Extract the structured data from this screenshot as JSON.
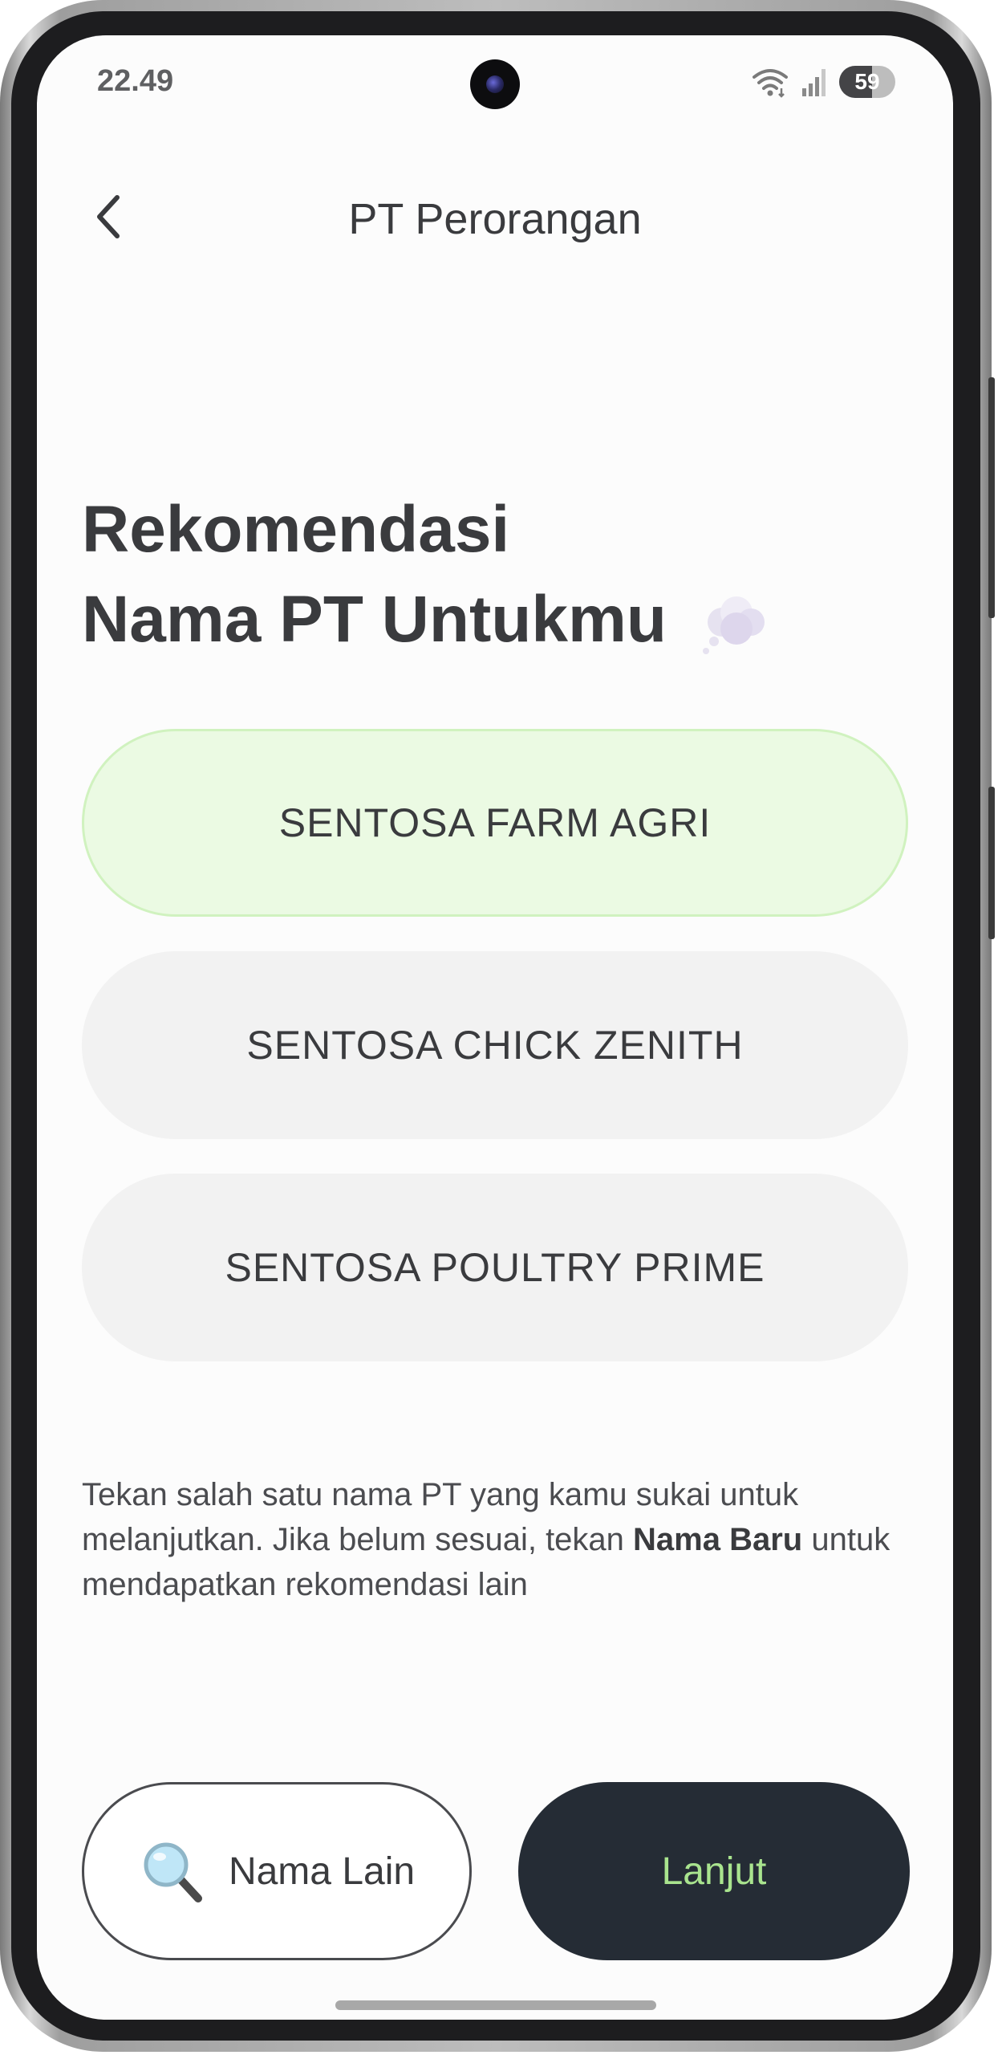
{
  "status_bar": {
    "time": "22.49",
    "battery_level": "59",
    "battery_fraction": 0.59,
    "icons": [
      "wifi-icon",
      "signal-icon",
      "battery-icon"
    ]
  },
  "header": {
    "title": "PT Perorangan",
    "back_icon": "chevron-left-icon"
  },
  "heading": {
    "line1": "Rekomendasi",
    "line2": "Nama PT Untukmu",
    "emoji_icon": "thought-balloon-icon"
  },
  "options": [
    {
      "label": "SENTOSA FARM AGRI",
      "selected": true
    },
    {
      "label": "SENTOSA CHICK ZENITH",
      "selected": false
    },
    {
      "label": "SENTOSA POULTRY PRIME",
      "selected": false
    }
  ],
  "helper": {
    "text_before": "Tekan salah satu nama PT yang kamu sukai untuk melanjutkan. Jika belum sesuai, tekan ",
    "bold": "Nama Baru",
    "text_after": " untuk mendapatkan rekomendasi lain"
  },
  "actions": {
    "secondary_label": "Nama Lain",
    "secondary_icon": "magnifying-glass-icon",
    "primary_label": "Lanjut"
  },
  "colors": {
    "selected_bg": "#ebfae3",
    "option_bg": "#f2f2f2",
    "primary_bg": "#252c35",
    "primary_text": "#a9e48e",
    "text": "#3a3b3e"
  }
}
